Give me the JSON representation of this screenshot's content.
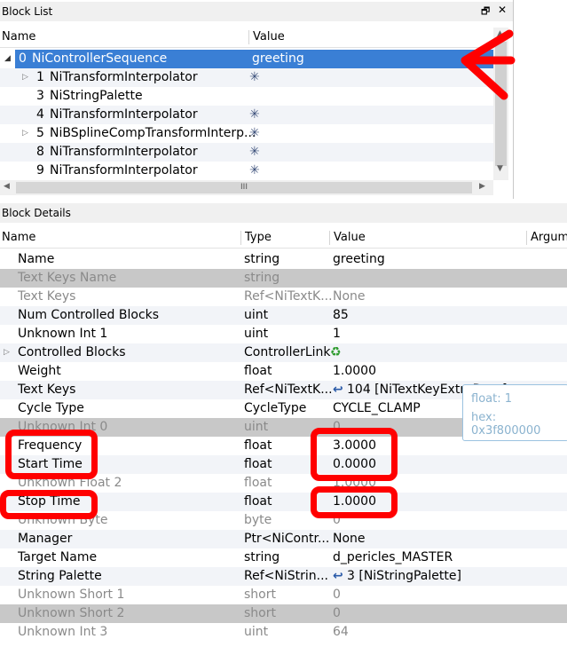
{
  "block_list": {
    "title": "Block List",
    "col_name": "Name",
    "col_value": "Value",
    "rows": [
      {
        "num": "0",
        "name": "NiControllerSequence",
        "value": "greeting"
      },
      {
        "num": "1",
        "name": "NiTransformInterpolator",
        "value": "✳"
      },
      {
        "num": "3",
        "name": "NiStringPalette",
        "value": ""
      },
      {
        "num": "4",
        "name": "NiTransformInterpolator",
        "value": "✳"
      },
      {
        "num": "5",
        "name": "NiBSplineCompTransformInterp...",
        "value": "✳"
      },
      {
        "num": "8",
        "name": "NiTransformInterpolator",
        "value": "✳"
      },
      {
        "num": "9",
        "name": "NiTransformInterpolator",
        "value": "✳"
      }
    ],
    "hscroll": "III"
  },
  "block_details": {
    "title": "Block Details",
    "col_name": "Name",
    "col_type": "Type",
    "col_value": "Value",
    "col_arg": "Argum",
    "rows": [
      {
        "name": "Name",
        "type": "string",
        "value": "greeting"
      },
      {
        "name": "Text Keys Name",
        "type": "string",
        "value": ""
      },
      {
        "name": "Text Keys",
        "type": "Ref<NiTextK...",
        "value": "None"
      },
      {
        "name": "Num Controlled Blocks",
        "type": "uint",
        "value": "85"
      },
      {
        "name": "Unknown Int 1",
        "type": "uint",
        "value": "1"
      },
      {
        "name": "Controlled Blocks",
        "type": "ControllerLink",
        "value": "♻"
      },
      {
        "name": "Weight",
        "type": "float",
        "value": "1.0000"
      },
      {
        "name": "Text Keys",
        "type": "Ref<NiTextK...",
        "value": "104 [NiTextKeyExtraData]"
      },
      {
        "name": "Cycle Type",
        "type": "CycleType",
        "value": "CYCLE_CLAMP"
      },
      {
        "name": "Unknown Int 0",
        "type": "uint",
        "value": "0"
      },
      {
        "name": "Frequency",
        "type": "float",
        "value": "3.0000"
      },
      {
        "name": "Start Time",
        "type": "float",
        "value": "0.0000"
      },
      {
        "name": "Unknown Float 2",
        "type": "float",
        "value": "1.0000"
      },
      {
        "name": "Stop Time",
        "type": "float",
        "value": "1.0000"
      },
      {
        "name": "Unknown Byte",
        "type": "byte",
        "value": "0"
      },
      {
        "name": "Manager",
        "type": "Ptr<NiContr...",
        "value": "None"
      },
      {
        "name": "Target Name",
        "type": "string",
        "value": "d_pericles_MASTER"
      },
      {
        "name": "String Palette",
        "type": "Ref<NiStrin...",
        "value": "3 [NiStringPalette]"
      },
      {
        "name": "Unknown Short 1",
        "type": "short",
        "value": "0"
      },
      {
        "name": "Unknown Short 2",
        "type": "short",
        "value": "0"
      },
      {
        "name": "Unknown Int 3",
        "type": "uint",
        "value": "64"
      }
    ]
  },
  "tooltip": {
    "line1": "float: 1",
    "line2": "hex: 0x3f800000"
  },
  "title_buttons": {
    "float": "🗗",
    "close": "✕"
  },
  "colors": {
    "selection": "#3a7fd5",
    "annotation": "#ff0000",
    "disabled_row": "#c8c8c8"
  }
}
